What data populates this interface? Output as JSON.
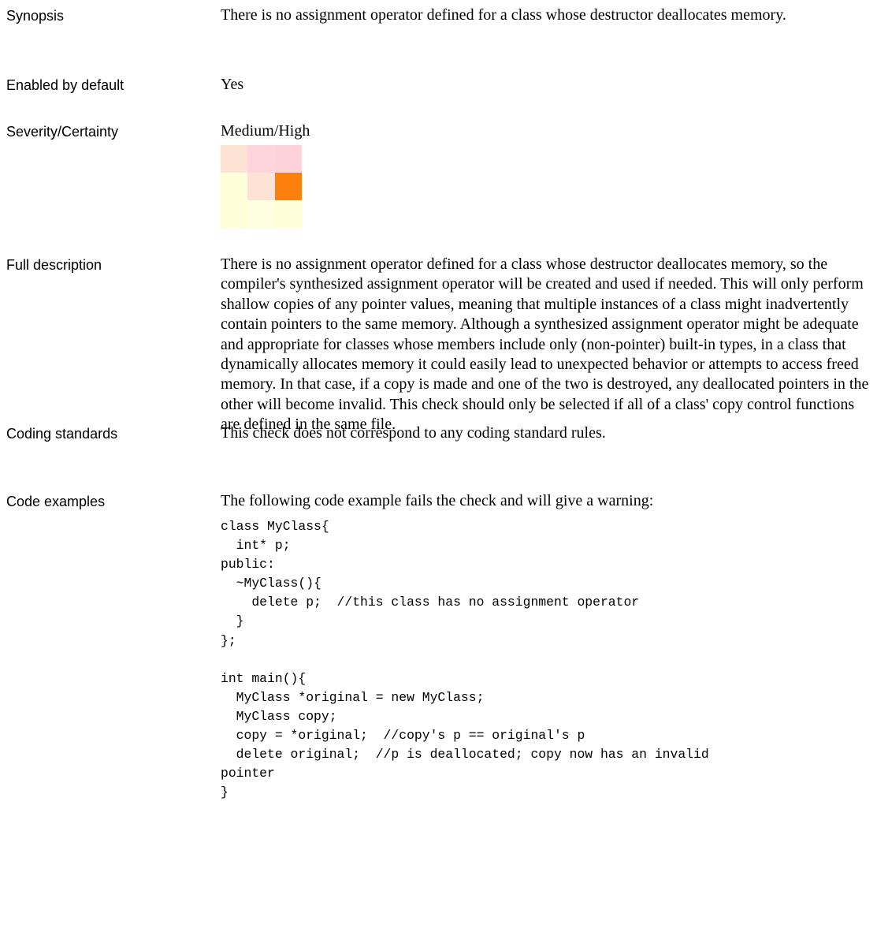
{
  "rows": {
    "synopsis": {
      "label": "Synopsis",
      "text": "There is no assignment operator defined for a class whose destructor deallocates memory."
    },
    "enabled": {
      "label": "Enabled by default",
      "text": "Yes"
    },
    "severity": {
      "label": "Severity/Certainty",
      "text": "Medium/High"
    },
    "full_description": {
      "label": "Full description",
      "text": "There is no assignment operator defined for a class whose destructor deallocates memory, so the compiler's synthesized assignment operator will be created and used if needed. This will only perform shallow copies of any pointer values, meaning that multiple instances of a class might inadvertently contain pointers to the same memory. Although a synthesized assignment operator might be adequate and appropriate for classes whose members include only (non-pointer) built-in types, in a class that dynamically allocates memory it could easily lead to unexpected behavior or attempts to access freed memory. In that case, if a copy is made and one of the two is destroyed, any deallocated pointers in the other will become invalid.  This check should only be selected if all of a class' copy control functions are defined in the same file."
    },
    "coding_standards": {
      "label": "Coding standards",
      "text": "This check does not correspond to any coding standard rules."
    },
    "code_examples": {
      "label": "Code examples",
      "intro": "The following code example fails the check and will give a warning:",
      "lines": [
        "class MyClass{",
        "  int* p;",
        "public:",
        "  ~MyClass(){",
        "    delete p;  //this class has no assignment operator",
        "  }",
        "};",
        "",
        "int main(){",
        "  MyClass *original = new MyClass;",
        "  MyClass copy;",
        "  copy = *original;  //copy's p == original's p",
        "  delete original;  //p is deallocated; copy now has an invalid",
        "pointer",
        "}"
      ]
    }
  },
  "severity_matrix": {
    "rows": [
      [
        "#fde3d4",
        "#fdd5da",
        "#fdd2d8"
      ],
      [
        "#fefed9",
        "#fde3d4",
        "#fd7f0d"
      ],
      [
        "#fefed9",
        "#fefee1",
        "#fefed9"
      ]
    ]
  }
}
